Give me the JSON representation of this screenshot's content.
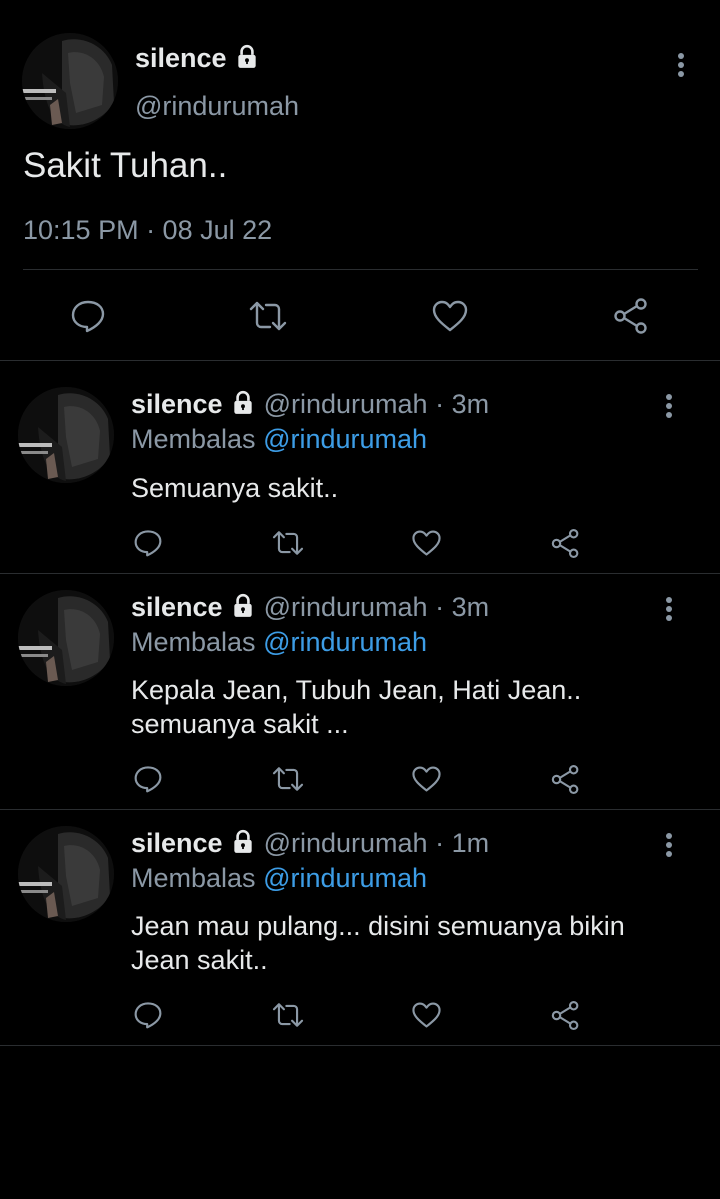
{
  "main_tweet": {
    "display_name": "silence",
    "handle": "@rindurumah",
    "text": "Sakit Tuhan..",
    "timestamp": "10:15 PM · 08 Jul 22",
    "icons": [
      "reply-icon",
      "retweet-icon",
      "like-icon",
      "share-icon",
      "more-icon",
      "lock-icon"
    ]
  },
  "replies": [
    {
      "display_name": "silence",
      "handle": "@rindurumah",
      "time": "· 3m",
      "replying_label": "Membalas",
      "replying_to": "@rindurumah",
      "text_lines": [
        "Semuanya sakit.."
      ]
    },
    {
      "display_name": "silence",
      "handle": "@rindurumah",
      "time": "· 3m",
      "replying_label": "Membalas",
      "replying_to": "@rindurumah",
      "text_lines": [
        "Kepala Jean, Tubuh Jean, Hati Jean..",
        "semuanya sakit ..."
      ]
    },
    {
      "display_name": "silence",
      "handle": "@rindurumah",
      "time": "· 1m",
      "replying_label": "Membalas",
      "replying_to": "@rindurumah",
      "text_lines": [
        "Jean mau pulang... disini semuanya bikin",
        "Jean sakit.."
      ]
    }
  ],
  "colors": {
    "background": "#000000",
    "text": "#e7e9ea",
    "muted": "#8b98a5",
    "link": "#3d9de6",
    "divider": "#2a2d30"
  }
}
